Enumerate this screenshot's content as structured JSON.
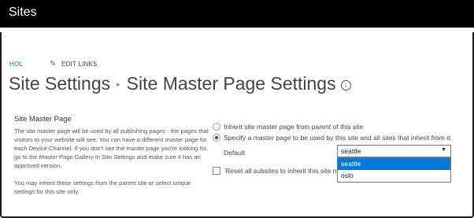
{
  "header": {
    "site_title": "Sites"
  },
  "nav": {
    "home_link": "HOL",
    "edit_links": "EDIT LINKS"
  },
  "page": {
    "breadcrumb_parent": "Site Settings",
    "title": "Site Master Page Settings",
    "info_icon": "info-icon"
  },
  "section": {
    "title": "Site Master Page",
    "description_1": "The site master page will be used by all publishing pages - the pages that visitors to your website will see. You can have a different master page for each Device Channel. If you don't see the master page you're looking for, go to the Master Page Gallery in Site Settings and make sure it has an approved version.",
    "description_2": "You may inherit these settings from the parent site or select unique settings for this site only."
  },
  "options": {
    "inherit_label": "Inherit site master page from parent of this site",
    "inherit_selected": false,
    "specify_label": "Specify a master page to be used by this site and all sites that inherit from it:",
    "specify_selected": true
  },
  "master_page": {
    "default_label": "Default",
    "selected_value": "seattle",
    "options": [
      "seattle",
      "oslo"
    ],
    "highlighted_option": "seattle"
  },
  "subsites": {
    "reset_label": "Reset all subsites to inherit this site master page setting",
    "checked": false
  },
  "colors": {
    "topbar": "#000000",
    "link": "#0072c6",
    "highlight": "#0078d7"
  }
}
